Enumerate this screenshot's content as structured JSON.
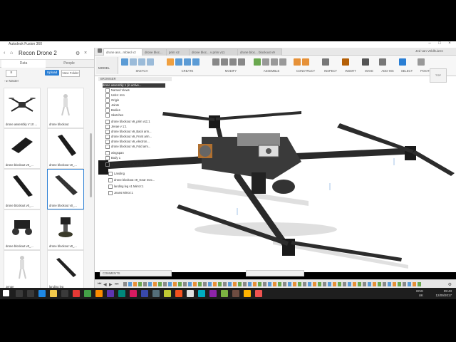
{
  "window": {
    "title": "Autodesk Fusion 360"
  },
  "data_panel": {
    "title": "Recon Drone 2",
    "tabs": [
      "Data",
      "People"
    ],
    "upload_label": "Upload",
    "new_folder_label": "New Folder",
    "breadcrumb": "Master",
    "items": [
      {
        "label": "drone assembly V 10 ..."
      },
      {
        "label": "drone blockout"
      },
      {
        "label": "drone blockout v0_..."
      },
      {
        "label": "drone blockout v0_..."
      },
      {
        "label": "drone blockout v0_..."
      },
      {
        "label": "drone blockout v0_..."
      },
      {
        "label": "drone blockout v0_..."
      },
      {
        "label": "drone blockout v0_..."
      },
      {
        "label": "Jenae"
      },
      {
        "label": "landing leg"
      }
    ]
  },
  "doc_tabs": [
    {
      "label": "drone ass...mbled v2",
      "active": true
    },
    {
      "label": "drone bloc..."
    },
    {
      "label": "prim v2"
    },
    {
      "label": "drone bloc... v prim v11"
    },
    {
      "label": "drone bloc... blockout v9"
    }
  ],
  "user": "Jed van Veldhuizen",
  "toolbar": {
    "model_label": "MODEL",
    "groups": [
      "SKETCH",
      "CREATE",
      "MODIFY",
      "ASSEMBLE",
      "CONSTRUCT",
      "INSPECT",
      "INSERT",
      "MAKE",
      "ADD-INS",
      "SELECT",
      "POSITION"
    ]
  },
  "browser": {
    "header": "BROWSER",
    "rows": [
      {
        "label": "drone assembly 1 (in active...",
        "highlight": true
      },
      {
        "label": "Named Views"
      },
      {
        "label": "Units: mm"
      },
      {
        "label": "Origin"
      },
      {
        "label": "Joints"
      },
      {
        "label": "Bodies"
      },
      {
        "label": "Sketches"
      },
      {
        "label": "drone blockout v9_prim v11:1"
      },
      {
        "label": "Jenae v 1:1"
      },
      {
        "label": "drone blockout v9_Back arm..."
      },
      {
        "label": "drone blockout v9_Front arm..."
      },
      {
        "label": "drone blockout v9_electron..."
      },
      {
        "label": "drone blockout v9_Fold arm..."
      },
      {
        "label": "wingspan"
      },
      {
        "label": "Body 1"
      },
      {
        "label": "drone blockout v9_Gear arm V10..."
      },
      {
        "label": "Landing"
      },
      {
        "label": "drone blockout v9_Gear mec..."
      },
      {
        "label": "landing leg v1 Mirror:1"
      },
      {
        "label": "Jeans Mirror:1"
      }
    ]
  },
  "viewcube": "TOP",
  "comments_label": "COMMENTS",
  "taskbar": {
    "lang": "ENG",
    "region": "UK",
    "time": "09:43",
    "date": "12/09/2017"
  },
  "colors": {
    "accent": "#2b7fd4",
    "highlight_row": "#3a3a3a",
    "taskbar": "#1e1e1e"
  }
}
